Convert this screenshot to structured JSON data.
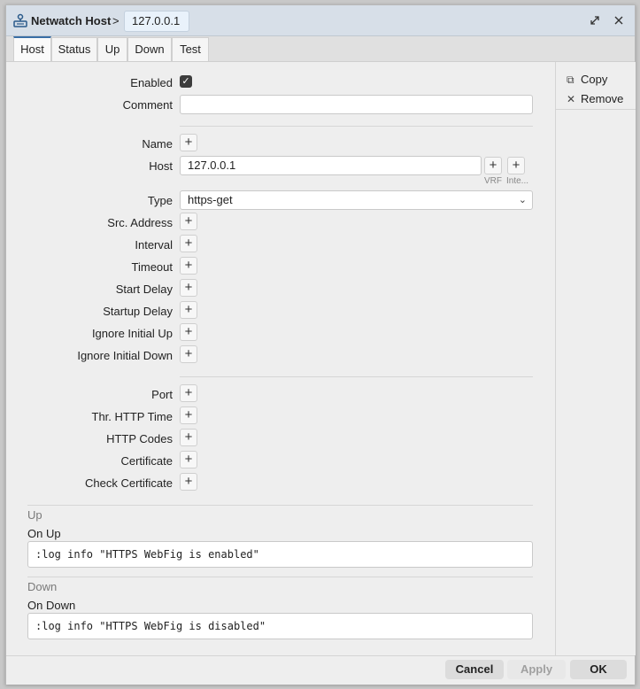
{
  "window": {
    "title": "Netwatch Host",
    "separator": ">",
    "item_name": "127.0.0.1"
  },
  "tabs": [
    {
      "label": "Host",
      "active": true
    },
    {
      "label": "Status"
    },
    {
      "label": "Up"
    },
    {
      "label": "Down"
    },
    {
      "label": "Test"
    }
  ],
  "side": {
    "copy_label": "Copy",
    "remove_label": "Remove"
  },
  "form": {
    "enabled_label": "Enabled",
    "enabled_checked": true,
    "comment_label": "Comment",
    "comment_value": "",
    "name_label": "Name",
    "host_label": "Host",
    "host_value": "127.0.0.1",
    "vrf_label": "VRF",
    "interface_label": "Inte...",
    "type_label": "Type",
    "type_value": "https-get",
    "src_address_label": "Src. Address",
    "interval_label": "Interval",
    "timeout_label": "Timeout",
    "start_delay_label": "Start Delay",
    "startup_delay_label": "Startup Delay",
    "ignore_initial_up_label": "Ignore Initial Up",
    "ignore_initial_down_label": "Ignore Initial Down",
    "port_label": "Port",
    "thr_http_time_label": "Thr. HTTP Time",
    "http_codes_label": "HTTP Codes",
    "certificate_label": "Certificate",
    "check_certificate_label": "Check Certificate",
    "up_section": "Up",
    "on_up_label": "On Up",
    "on_up_value": ":log info \"HTTPS WebFig is enabled\"",
    "down_section": "Down",
    "on_down_label": "On Down",
    "on_down_value": ":log info \"HTTPS WebFig is disabled\""
  },
  "footer": {
    "cancel_label": "Cancel",
    "apply_label": "Apply",
    "ok_label": "OK"
  },
  "colors": {
    "accent": "#3a6ea5",
    "titlebar": "#d7dfe8"
  }
}
